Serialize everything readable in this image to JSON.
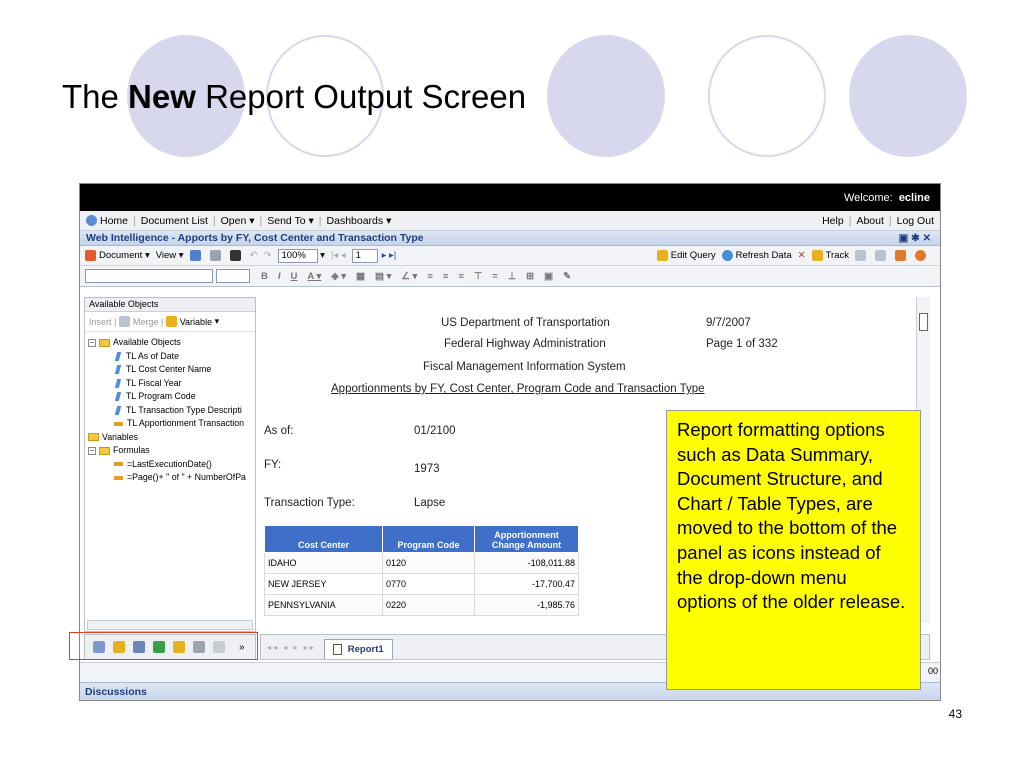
{
  "slide": {
    "title_pre": "The ",
    "title_bold": "New",
    "title_post": " Report Output Screen",
    "page_number": "43",
    "callout_text": "Report formatting options such as Data Summary, Document Structure, and Chart / Table Types, are moved to the bottom of the panel as icons instead of the drop-down menu options of the older release."
  },
  "app": {
    "welcome_label": "Welcome:",
    "user": "ecline",
    "nav_left": [
      "Home",
      "Document List",
      "Open",
      "Send To",
      "Dashboards"
    ],
    "nav_right": [
      "Help",
      "About",
      "Log Out"
    ],
    "doc_title": "Web Intelligence - Apports by FY, Cost Center and Transaction Type",
    "toolbar": {
      "document_label": "Document",
      "view_label": "View",
      "zoom": "100%",
      "page_input": "1",
      "edit_query": "Edit Query",
      "refresh_data": "Refresh Data",
      "track": "Track"
    },
    "left_panel": {
      "title": "Available Objects",
      "insert": "Insert",
      "merge": "Merge",
      "variable": "Variable",
      "tree": [
        {
          "label": "Available Objects",
          "type": "folder",
          "level": 0
        },
        {
          "label": "TL As of Date",
          "type": "dimension",
          "level": 2
        },
        {
          "label": "TL Cost Center Name",
          "type": "dimension",
          "level": 2
        },
        {
          "label": "TL Fiscal Year",
          "type": "dimension",
          "level": 2
        },
        {
          "label": "TL Program Code",
          "type": "dimension",
          "level": 2
        },
        {
          "label": "TL Transaction Type Descripti",
          "type": "dimension",
          "level": 2
        },
        {
          "label": "TL Apportionment Transaction",
          "type": "measure",
          "level": 2
        },
        {
          "label": "Variables",
          "type": "folder",
          "level": 0
        },
        {
          "label": "Formulas",
          "type": "folder",
          "level": 0
        },
        {
          "label": "=LastExecutionDate()",
          "type": "measure",
          "level": 2
        },
        {
          "label": "=Page()+ \" of \" + NumberOfPa",
          "type": "measure",
          "level": 2
        }
      ]
    },
    "report": {
      "header_line1": "US Department of Transportation",
      "date": "9/7/2007",
      "header_line2": "Federal Highway Administration",
      "page_info": "Page 1 of 332",
      "header_line3": "Fiscal Management Information System",
      "header_line4": "Apportionments by FY, Cost Center, Program Code and Transaction Type",
      "as_of_label": "As of:",
      "as_of_value": "01/2100",
      "fy_label": "FY:",
      "fy_value": "1973",
      "tt_label": "Transaction Type:",
      "tt_value": "Lapse",
      "table": {
        "columns": [
          "Cost Center",
          "Program Code",
          "Apportionment Change Amount"
        ],
        "rows": [
          [
            "IDAHO",
            "0120",
            "-108,011.88"
          ],
          [
            "NEW JERSEY",
            "0770",
            "-17,700.47"
          ],
          [
            "PENNSYLVANIA",
            "0220",
            "-1,985.76"
          ]
        ]
      }
    },
    "report_tab": "Report1",
    "status_right": "00",
    "discussions": "Discussions"
  },
  "colors": {
    "circle_fill": "#d7d7ed",
    "callout_bg": "#ffff00",
    "table_header": "#3f6fc9",
    "highlight_border": "#e04020"
  }
}
